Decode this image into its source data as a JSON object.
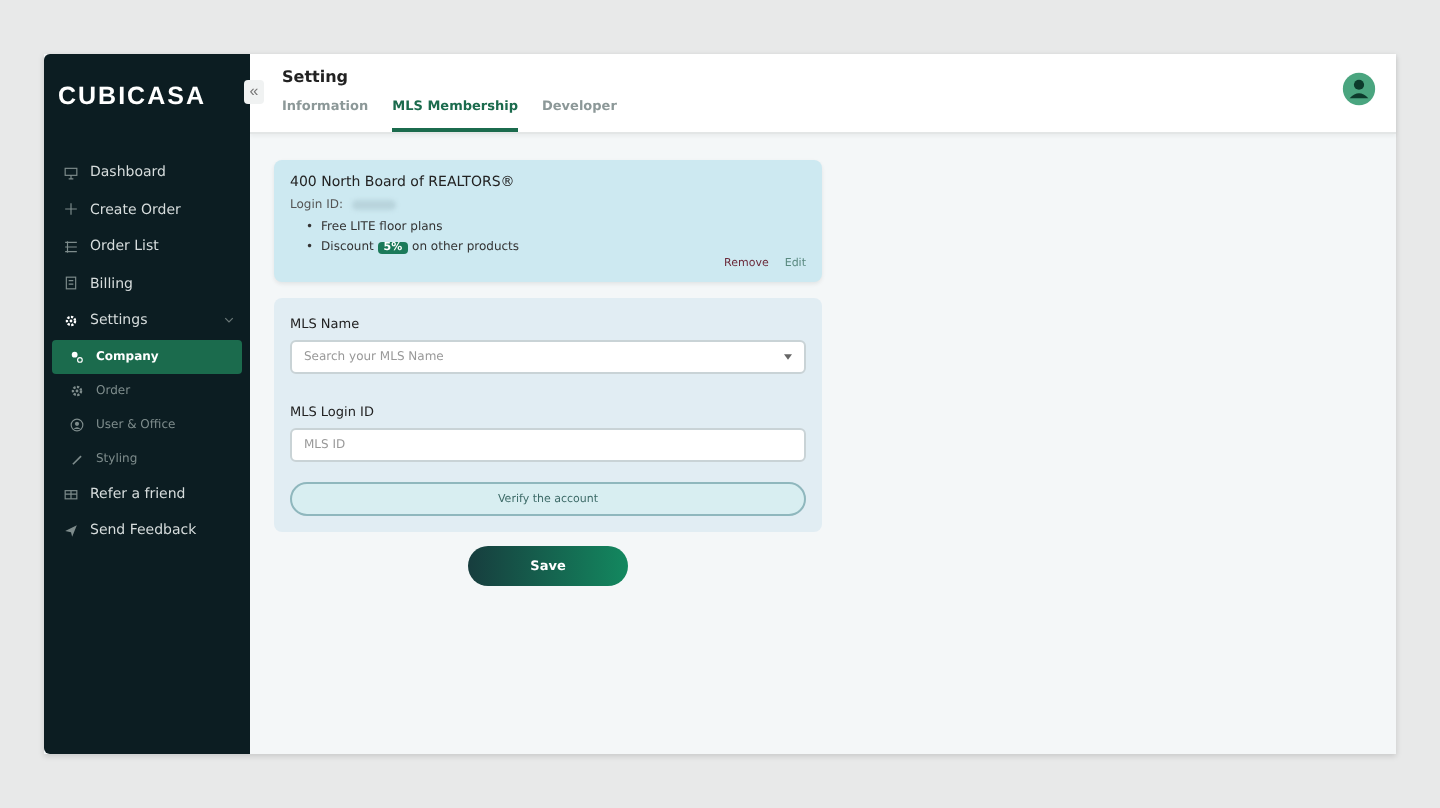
{
  "logo": "CUBICASA",
  "sidebar": {
    "items": [
      {
        "label": "Dashboard",
        "kind": "main",
        "selected": false
      },
      {
        "label": "Create Order",
        "kind": "main",
        "selected": false
      },
      {
        "label": "Order List",
        "kind": "main",
        "selected": false
      },
      {
        "label": "Billing",
        "kind": "main",
        "selected": false
      },
      {
        "label": "Settings",
        "kind": "main",
        "selected": false,
        "expanded": true
      },
      {
        "label": "Company",
        "kind": "sub",
        "selected": true
      },
      {
        "label": "Order",
        "kind": "sub",
        "selected": false
      },
      {
        "label": "User & Office",
        "kind": "sub",
        "selected": false
      },
      {
        "label": "Styling",
        "kind": "sub",
        "selected": false
      },
      {
        "label": "Refer a friend",
        "kind": "main",
        "selected": false
      },
      {
        "label": "Send Feedback",
        "kind": "main",
        "selected": false
      }
    ]
  },
  "collapse_button": "«",
  "header": {
    "title": "Setting",
    "tabs": [
      {
        "label": "Information",
        "selected": false
      },
      {
        "label": "MLS Membership",
        "selected": true
      },
      {
        "label": "Developer",
        "selected": false
      }
    ]
  },
  "membership_card": {
    "title": "400 North Board of REALTORS®",
    "login_label": "Login ID:",
    "bullet": "•",
    "benefits": [
      "Free LITE floor plans",
      "Discount **5%** on other products"
    ],
    "actions": [
      "Remove",
      "Edit"
    ]
  },
  "form": {
    "mls_name": {
      "label": "MLS Name",
      "placeholder": "Search your MLS Name"
    },
    "login_id": {
      "label": "MLS Login ID",
      "placeholder": "MLS ID"
    },
    "verify_button": "Verify the account"
  },
  "save_button": "Save"
}
